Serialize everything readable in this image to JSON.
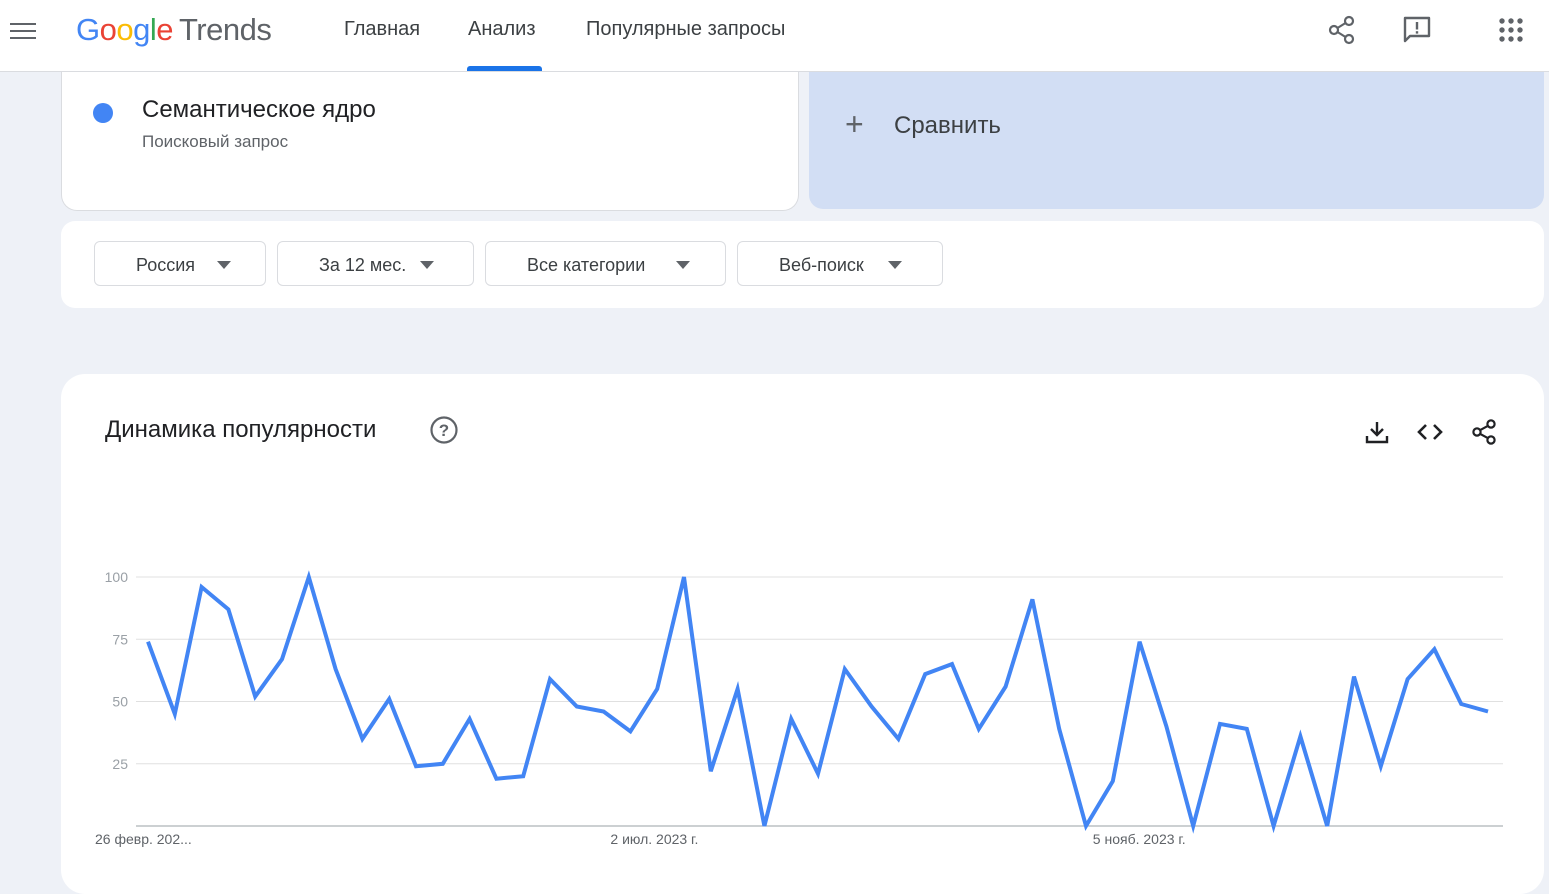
{
  "header": {
    "logo_google": "Google",
    "logo_trends": "Trends",
    "nav": [
      "Главная",
      "Анализ",
      "Популярные запросы"
    ],
    "active_nav": "Анализ",
    "icons": [
      "menu-icon",
      "share-icon",
      "feedback-icon",
      "apps-grid-icon"
    ]
  },
  "search_term": {
    "title": "Семантическое ядро",
    "subtitle": "Поисковый запрос",
    "color": "#4285f4"
  },
  "compare": {
    "label": "Сравнить"
  },
  "filters": [
    {
      "label": "Россия"
    },
    {
      "label": "За 12 мес."
    },
    {
      "label": "Все категории"
    },
    {
      "label": "Веб-поиск"
    }
  ],
  "chart_card": {
    "title": "Динамика популярности",
    "icons": [
      "help-icon",
      "download-icon",
      "embed-code-icon",
      "share-icon"
    ]
  },
  "chart_data": {
    "type": "line",
    "title": "Динамика популярности",
    "xlabel": "",
    "ylabel": "",
    "ylim": [
      0,
      100
    ],
    "yticks": [
      25,
      50,
      75,
      100
    ],
    "x_tick_labels": [
      "26 февр. 202...",
      "2 июл. 2023 г.",
      "5 нояб. 2023 г."
    ],
    "x_tick_indices": [
      0,
      18,
      36
    ],
    "grid": true,
    "series": [
      {
        "name": "Семантическое ядро",
        "color": "#4285f4",
        "values": [
          74,
          45,
          96,
          87,
          52,
          67,
          100,
          63,
          35,
          51,
          24,
          25,
          43,
          19,
          20,
          59,
          48,
          46,
          38,
          55,
          100,
          22,
          55,
          0,
          43,
          21,
          63,
          48,
          35,
          61,
          65,
          39,
          56,
          91,
          39,
          0,
          18,
          74,
          40,
          0,
          41,
          39,
          0,
          36,
          0,
          60,
          24,
          59,
          71,
          49,
          46
        ]
      }
    ]
  }
}
